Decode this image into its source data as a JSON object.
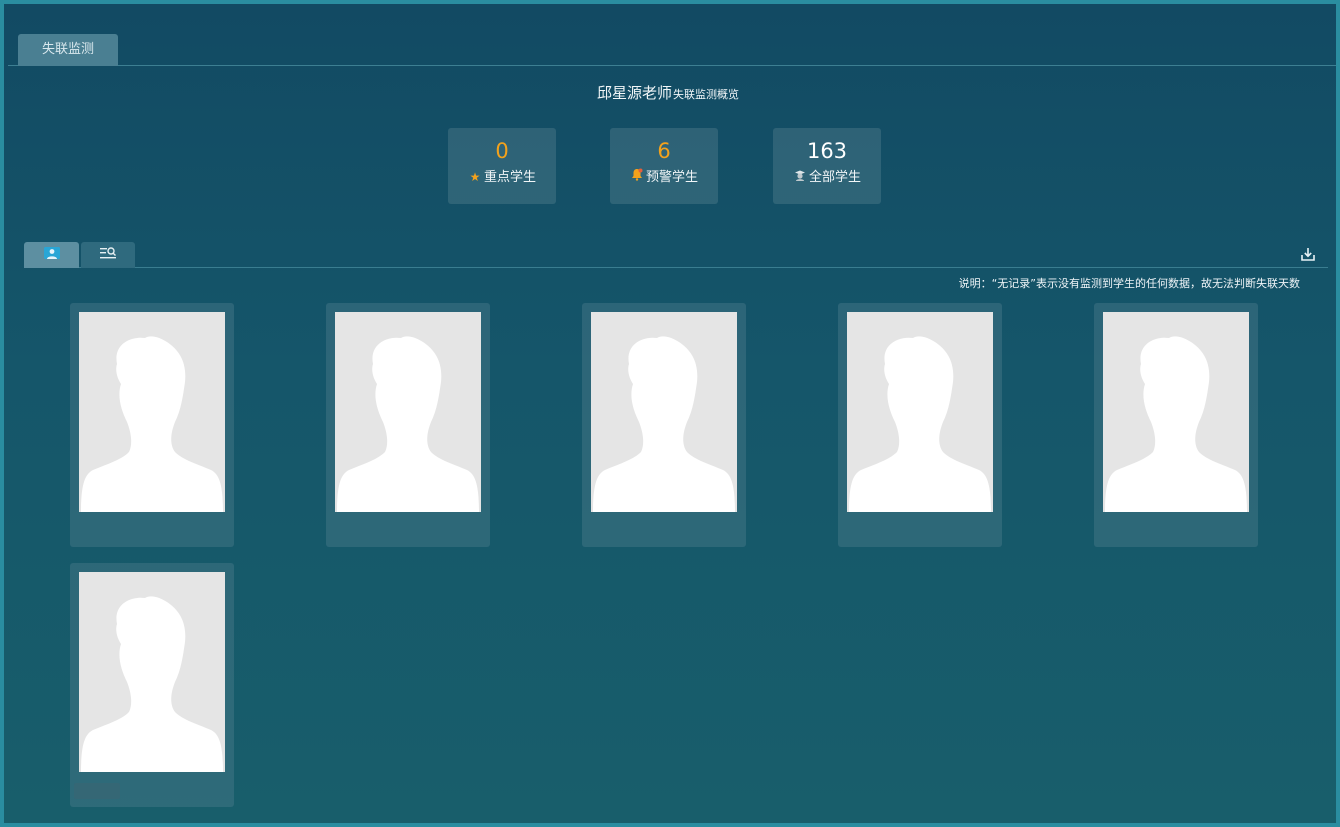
{
  "window": {
    "tab_label": "失联监测"
  },
  "overview": {
    "teacher": "邱星源老师",
    "subtitle": "失联监测概览"
  },
  "stats": [
    {
      "value": "0",
      "label": "重点学生",
      "icon": "star-icon"
    },
    {
      "value": "6",
      "label": "预警学生",
      "icon": "bell-alert-icon"
    },
    {
      "value": "163",
      "label": "全部学生",
      "icon": "student-icon"
    }
  ],
  "view_tabs": [
    {
      "name": "grid-view-tab",
      "icon": "photo-grid-icon",
      "active": true
    },
    {
      "name": "list-search-tab",
      "icon": "list-search-icon",
      "active": false
    }
  ],
  "note": "说明：“无记录”表示没有监测到学生的任何数据，故无法判断失联天数",
  "students": [
    {
      "photo": "avatar-placeholder"
    },
    {
      "photo": "avatar-placeholder"
    },
    {
      "photo": "avatar-placeholder"
    },
    {
      "photo": "avatar-placeholder"
    },
    {
      "photo": "avatar-placeholder"
    },
    {
      "photo": "avatar-placeholder"
    }
  ],
  "colors": {
    "accent": "#f3a21c",
    "background": "#124a63",
    "border": "#2a8da0",
    "active_tab": "#5d8fa1"
  }
}
